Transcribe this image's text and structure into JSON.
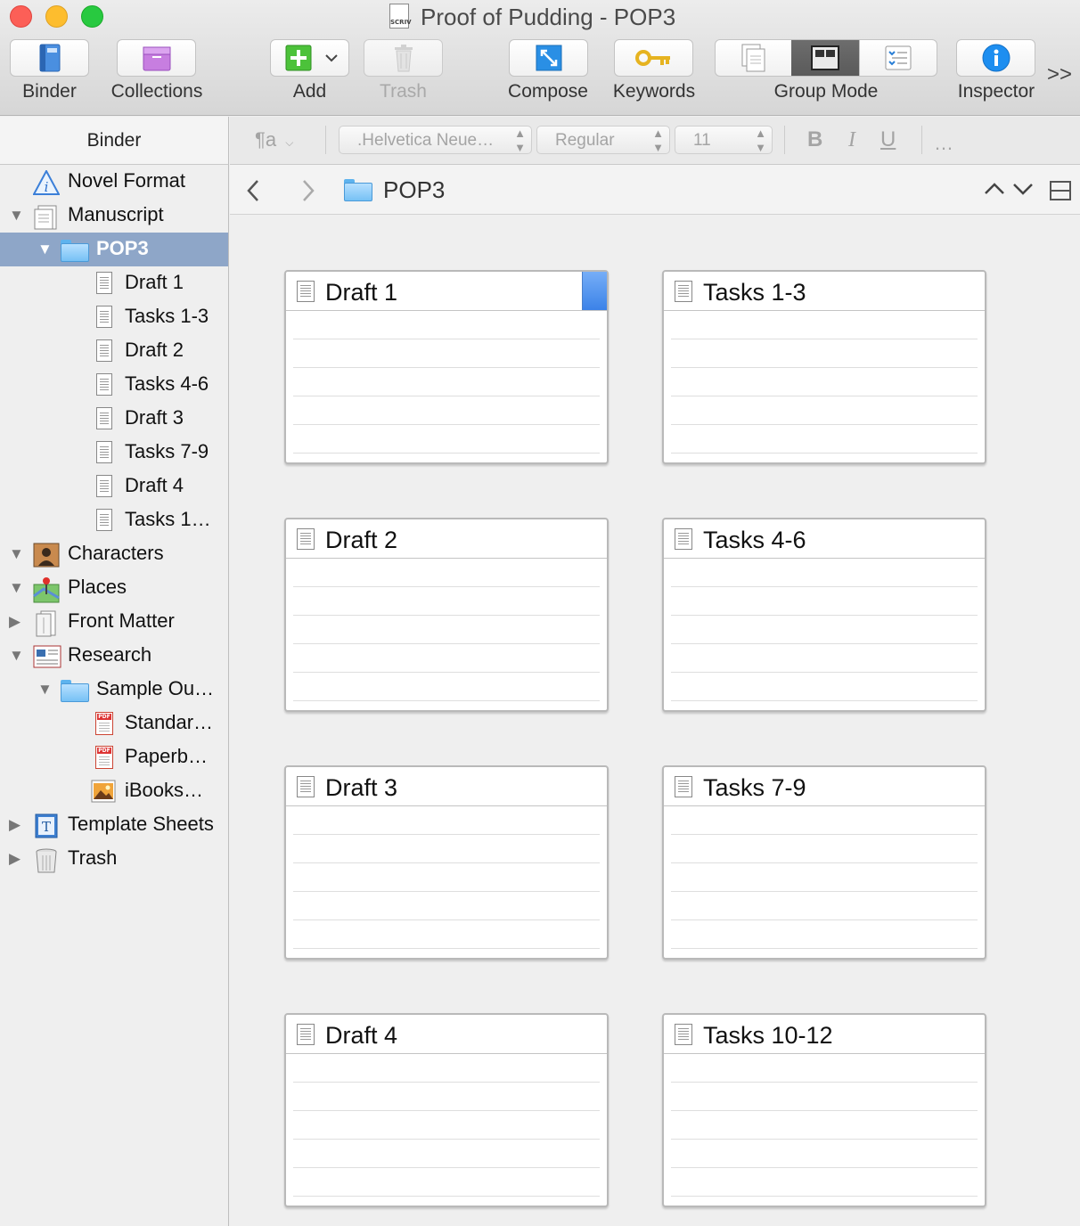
{
  "window": {
    "title": "Proof of Pudding - POP3",
    "doc_icon_text": "SCRIV"
  },
  "toolbar": {
    "binder": "Binder",
    "collections": "Collections",
    "add": "Add",
    "trash": "Trash",
    "compose": "Compose",
    "keywords": "Keywords",
    "group_mode": "Group Mode",
    "inspector": "Inspector",
    "overflow": ">>"
  },
  "binder": {
    "header": "Binder",
    "items": [
      {
        "label": "Novel Format",
        "icon": "info-icon"
      },
      {
        "label": "Manuscript",
        "icon": "manuscript-icon"
      },
      {
        "label": "POP3",
        "icon": "folder-icon"
      },
      {
        "label": "Draft 1",
        "icon": "document-icon"
      },
      {
        "label": "Tasks 1-3",
        "icon": "document-icon"
      },
      {
        "label": "Draft 2",
        "icon": "document-icon"
      },
      {
        "label": "Tasks 4-6",
        "icon": "document-icon"
      },
      {
        "label": "Draft 3",
        "icon": "document-icon"
      },
      {
        "label": "Tasks 7-9",
        "icon": "document-icon"
      },
      {
        "label": "Draft 4",
        "icon": "document-icon"
      },
      {
        "label": "Tasks 1…",
        "icon": "document-icon"
      },
      {
        "label": "Characters",
        "icon": "characters-icon"
      },
      {
        "label": "Places",
        "icon": "places-icon"
      },
      {
        "label": "Front Matter",
        "icon": "front-matter-icon"
      },
      {
        "label": "Research",
        "icon": "research-icon"
      },
      {
        "label": "Sample Ou…",
        "icon": "folder-icon"
      },
      {
        "label": "Standar…",
        "icon": "pdf-icon"
      },
      {
        "label": "Paperb…",
        "icon": "pdf-icon"
      },
      {
        "label": "iBooks…",
        "icon": "image-icon"
      },
      {
        "label": "Template Sheets",
        "icon": "template-icon"
      },
      {
        "label": "Trash",
        "icon": "trash-icon"
      }
    ]
  },
  "formatbar": {
    "paragraph": "¶a",
    "font": ".Helvetica Neue…",
    "style": "Regular",
    "size": "11",
    "bold": "B",
    "italic": "I",
    "underline": "U",
    "more": "…"
  },
  "editor": {
    "title": "POP3"
  },
  "corkboard": {
    "cards": [
      {
        "title": "Draft 1"
      },
      {
        "title": "Tasks 1-3"
      },
      {
        "title": "Draft 2"
      },
      {
        "title": "Tasks 4-6"
      },
      {
        "title": "Draft 3"
      },
      {
        "title": "Tasks 7-9"
      },
      {
        "title": "Draft 4"
      },
      {
        "title": "Tasks 10-12"
      }
    ]
  },
  "colors": {
    "selection": "#8ea6c8",
    "label_blue": "#3b82e8",
    "folder": "#76c1f5"
  }
}
